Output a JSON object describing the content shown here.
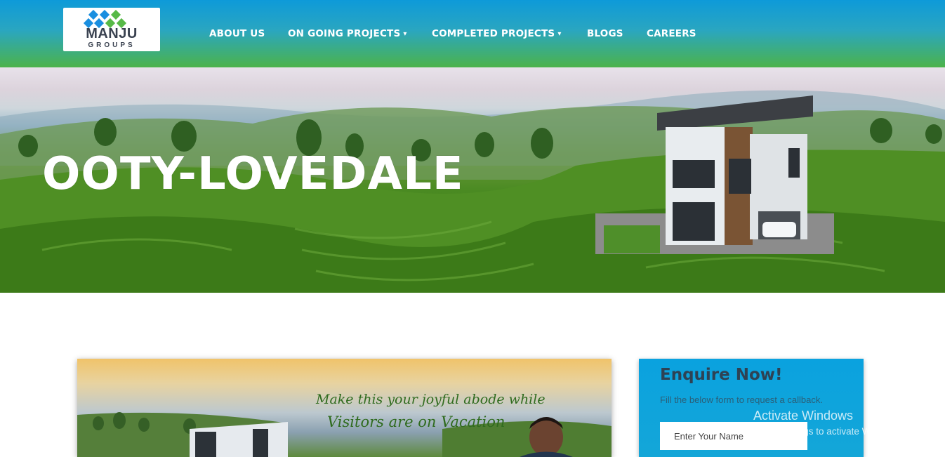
{
  "brand": {
    "name": "MANJU",
    "tagline": "GROUPS",
    "colors": {
      "blue": "#1a8fe0",
      "green": "#57b947"
    }
  },
  "nav": {
    "items": [
      {
        "label": "ABOUT US",
        "has_dropdown": false
      },
      {
        "label": "ON GOING PROJECTS",
        "has_dropdown": true
      },
      {
        "label": "COMPLETED PROJECTS",
        "has_dropdown": true
      },
      {
        "label": "BLOGS",
        "has_dropdown": false
      },
      {
        "label": "CAREERS",
        "has_dropdown": false
      }
    ],
    "caret_icon": "▾"
  },
  "hero": {
    "title": "OOTY-LOVEDALE"
  },
  "promo": {
    "line1": "Make this your joyful abode while",
    "line2": "Visitors are on Vacation"
  },
  "enquiry": {
    "title": "Enquire Now!",
    "subtitle": "Fill the below form to request a callback.",
    "name_placeholder": "Enter Your Name"
  },
  "watermark": {
    "line1": "Activate Windows",
    "line2": "Go to Settings to activate Windows."
  },
  "colors": {
    "header_top": "#0e9ad9",
    "header_bottom": "#4cb34a",
    "enquiry_bg": "#0aa2df"
  }
}
